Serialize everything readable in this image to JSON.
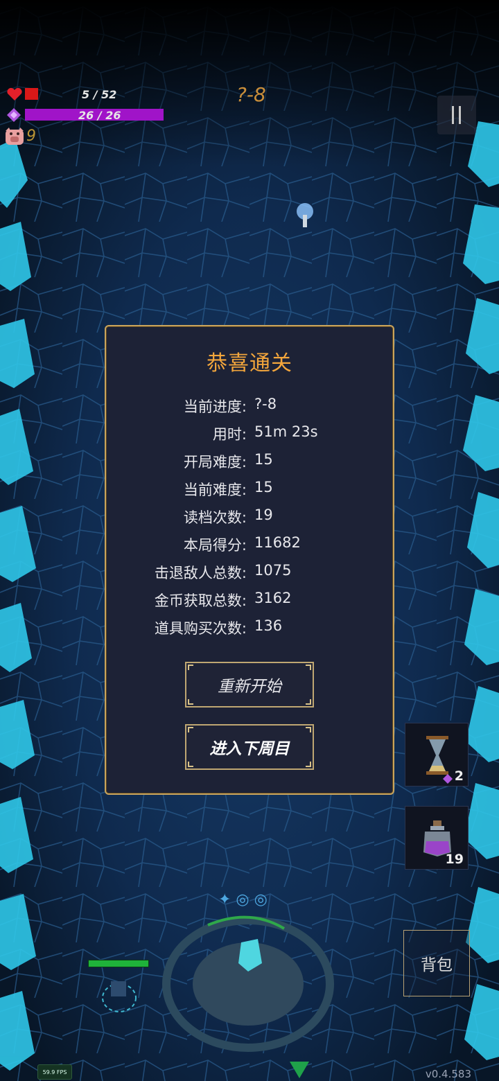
{
  "hud": {
    "hp_text": "5 / 52",
    "hp_fraction": 0.096,
    "mana_text": "26 / 26",
    "mana_fraction": 1.0,
    "coins": "9",
    "stage": "?-8",
    "heart_icon": "heart-icon",
    "mana_icon": "diamond-icon",
    "coin_icon": "pig-icon",
    "pause_icon": "pause-icon"
  },
  "colors": {
    "hp": "#d91818",
    "mana": "#a014c8",
    "accent_gold": "#f3a63c",
    "panel_border": "#c9a45c",
    "stage_text": "#c98e3a"
  },
  "panel": {
    "title": "恭喜通关",
    "stats": [
      {
        "label": "当前进度:",
        "value": "?-8"
      },
      {
        "label": "用时:",
        "value": "51m 23s"
      },
      {
        "label": "开局难度:",
        "value": "15"
      },
      {
        "label": "当前难度:",
        "value": "15"
      },
      {
        "label": "读档次数:",
        "value": "19"
      },
      {
        "label": "本局得分:",
        "value": "11682"
      },
      {
        "label": "击退敌人总数:",
        "value": "1075"
      },
      {
        "label": "金币获取总数:",
        "value": "3162"
      },
      {
        "label": "道具购买次数:",
        "value": "136"
      }
    ],
    "restart_label": "重新开始",
    "next_cycle_label": "进入下周目"
  },
  "items": [
    {
      "icon": "hourglass-icon",
      "cost_icon": "diamond-icon",
      "count": "2"
    },
    {
      "icon": "potion-icon",
      "count": "19"
    }
  ],
  "bag_label": "背包",
  "player_health_fraction": 1.0,
  "fps": "59.9 FPS",
  "version": "v0.4.583"
}
